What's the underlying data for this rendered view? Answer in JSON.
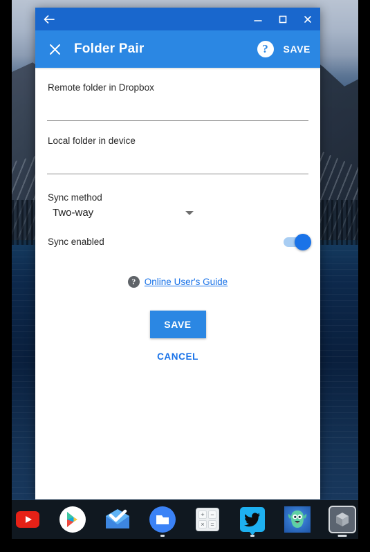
{
  "window": {
    "titlebar": {
      "back_icon": "back-arrow-icon",
      "minimize_icon": "minimize-icon",
      "maximize_icon": "maximize-icon",
      "close_icon": "close-icon"
    },
    "appbar": {
      "close_icon": "close-x-icon",
      "title": "Folder Pair",
      "help_icon": "help-circle-icon",
      "help_glyph": "?",
      "save_label": "SAVE"
    }
  },
  "form": {
    "remote": {
      "label": "Remote folder in Dropbox",
      "value": "",
      "placeholder": ""
    },
    "local": {
      "label": "Local folder in device",
      "value": "",
      "placeholder": ""
    },
    "sync_method": {
      "label": "Sync method",
      "value": "Two-way",
      "options": [
        "Two-way"
      ],
      "caret_icon": "chevron-down-icon"
    },
    "sync_enabled": {
      "label": "Sync enabled",
      "value": "on"
    },
    "guide": {
      "help_icon": "help-circle-icon",
      "help_glyph": "?",
      "link_label": "Online User's Guide"
    },
    "save_label": "SAVE",
    "cancel_label": "CANCEL"
  },
  "colors": {
    "titlebar_blue": "#1967cd",
    "appbar_blue": "#2b87e3",
    "accent_blue": "#1a73e8",
    "link_blue": "#1a73e8",
    "shelf_dark": "#101820"
  },
  "shelf": {
    "items": [
      {
        "name": "youtube",
        "label": "YouTube",
        "running": false
      },
      {
        "name": "play-store",
        "label": "Play Store",
        "running": false
      },
      {
        "name": "inbox",
        "label": "Inbox",
        "running": false
      },
      {
        "name": "files",
        "label": "Files",
        "running": true
      },
      {
        "name": "calculator",
        "label": "Calculator",
        "running": false
      },
      {
        "name": "twitter",
        "label": "Twitter",
        "running": true
      },
      {
        "name": "monster-app",
        "label": "Monster",
        "running": false
      },
      {
        "name": "package-app",
        "label": "Package",
        "running": true
      }
    ],
    "calculator_keys": [
      "+",
      "−",
      "×",
      "="
    ]
  }
}
